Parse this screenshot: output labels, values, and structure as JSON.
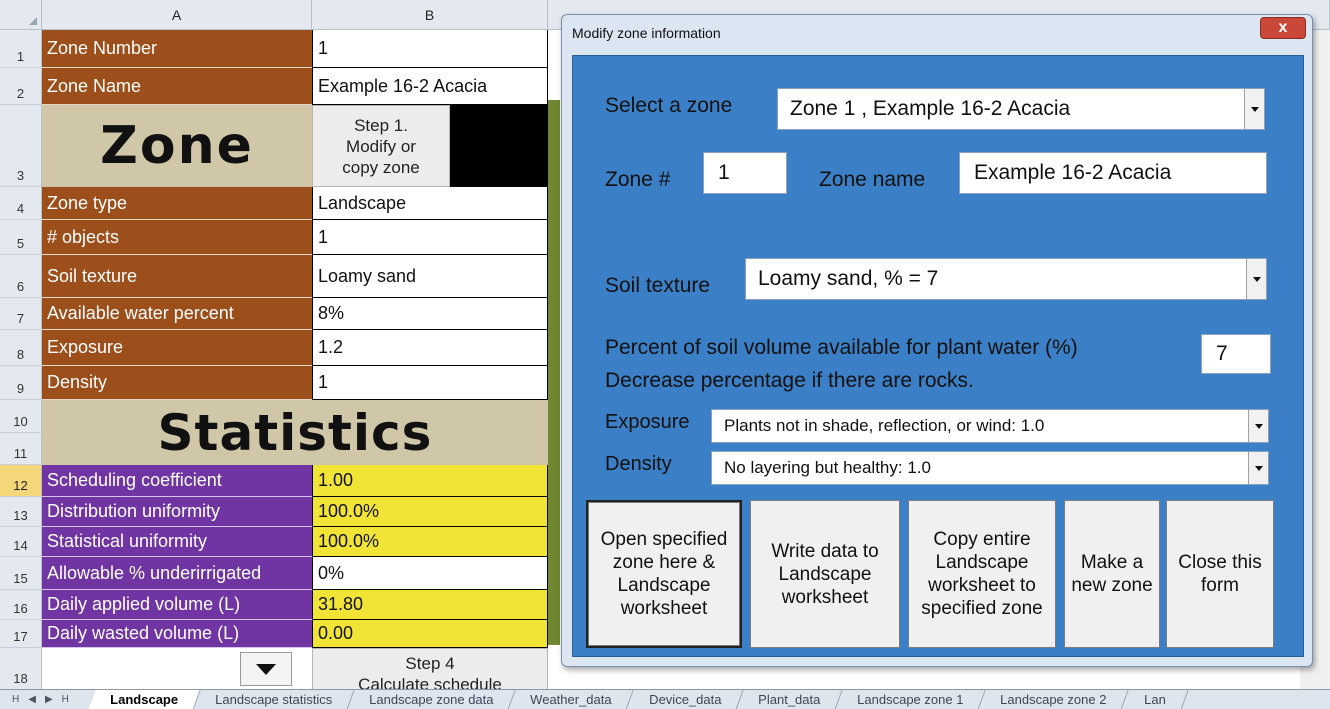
{
  "sheet": {
    "columns": {
      "a": "A",
      "b": "B"
    },
    "rows": [
      {
        "num": "1",
        "label": "Zone Number",
        "value": "1"
      },
      {
        "num": "2",
        "label": "Zone Name",
        "value": "Example 16-2 Acacia"
      },
      {
        "num": "4",
        "label": "Zone type",
        "value": "Landscape"
      },
      {
        "num": "5",
        "label": "# objects",
        "value": "1"
      },
      {
        "num": "6",
        "label": "Soil texture",
        "value": "Loamy sand"
      },
      {
        "num": "7",
        "label": "Available water percent",
        "value": "8%"
      },
      {
        "num": "8",
        "label": "Exposure",
        "value": "1.2"
      },
      {
        "num": "9",
        "label": "Density",
        "value": "1"
      },
      {
        "num": "12",
        "label": "Scheduling coefficient",
        "value": "1.00"
      },
      {
        "num": "13",
        "label": "Distribution uniformity",
        "value": "100.0%"
      },
      {
        "num": "14",
        "label": "Statistical uniformity",
        "value": "100.0%"
      },
      {
        "num": "15",
        "label": "Allowable % underirrigated",
        "value": "0%"
      },
      {
        "num": "16",
        "label": "Daily applied volume (L)",
        "value": "31.80"
      },
      {
        "num": "17",
        "label": "Daily wasted volume (L)",
        "value": "0.00"
      }
    ],
    "row3": "3",
    "row10": "10",
    "row11": "11",
    "row18": "18",
    "zone_banner": "Zone",
    "stats_banner": "Statistics",
    "step1": [
      "Step 1.",
      "Modify or",
      "copy zone"
    ],
    "step4": [
      "Step 4",
      "Calculate schedule"
    ],
    "selected_row": "12"
  },
  "tabs": {
    "nav": [
      "H",
      "◀",
      "▶",
      "H"
    ],
    "items": [
      "Landscape",
      "Landscape statistics",
      "Landscape zone data",
      "Weather_data",
      "Device_data",
      "Plant_data",
      "Landscape zone 1",
      "Landscape zone 2",
      "Lan"
    ],
    "active_index": 0
  },
  "dialog": {
    "title": "Modify zone information",
    "close_label": "x",
    "select_zone_label": "Select a zone",
    "select_zone_value": "Zone 1 , Example 16-2 Acacia",
    "zone_num_label": "Zone #",
    "zone_num_value": "1",
    "zone_name_label": "Zone name",
    "zone_name_value": "Example 16-2 Acacia",
    "soil_label": "Soil texture",
    "soil_value": "Loamy sand, % = 7",
    "percent_label_1": "Percent of soil volume available for plant water (%)",
    "percent_label_2": "Decrease percentage if there are rocks.",
    "percent_value": "7",
    "exposure_label": "Exposure",
    "exposure_value": "Plants not in shade, reflection, or wind: 1.0",
    "density_label": "Density",
    "density_value": "No layering but healthy: 1.0",
    "buttons": [
      "Open specified zone here & Landscape worksheet",
      "Write data to Landscape worksheet",
      "Copy entire Landscape worksheet to specified zone",
      "Make a new zone",
      "Close this form"
    ]
  },
  "colors": {
    "label_brown": "#9c4f1a",
    "label_purple": "#7135a3",
    "value_yellow": "#f2e437",
    "banner_tan": "#cfc7a7",
    "dialog_blue": "#3b80c6",
    "close_red": "#c9483a"
  }
}
